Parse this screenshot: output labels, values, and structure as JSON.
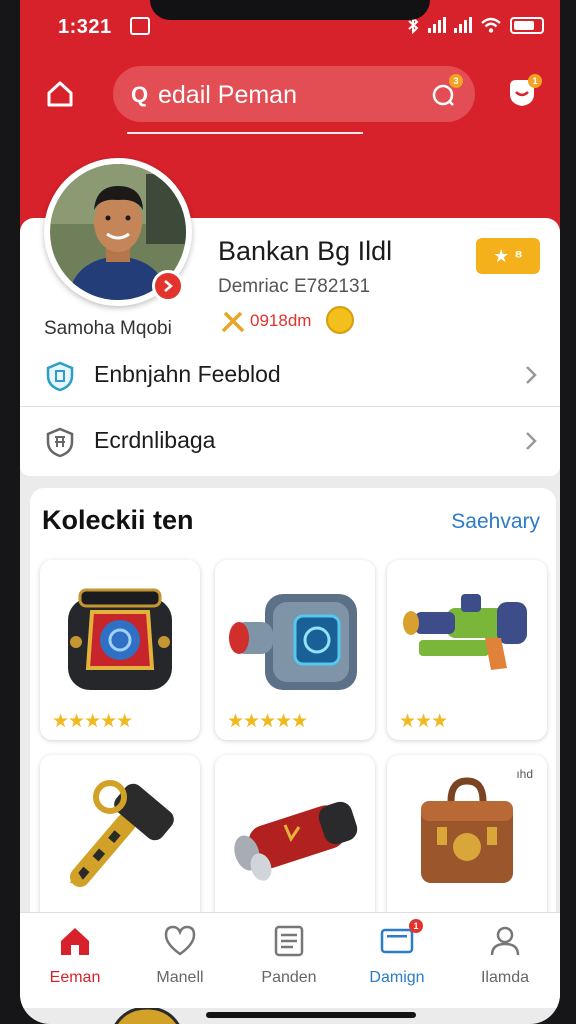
{
  "status_bar": {
    "time": "1:321"
  },
  "header": {
    "search_value": "edail Peman",
    "search_icon_glyph": "Q",
    "notification_badge": "3",
    "chat_badge": "1"
  },
  "profile": {
    "name": "Bankan Bg Ildl",
    "id_line": "Demriac E782131",
    "coins": "0918dm",
    "subname": "Samoha Mqobi",
    "rank_badge": "★ ⁸"
  },
  "menu": [
    {
      "icon": "shield-icon",
      "label": "Enbnjahn Feeblod"
    },
    {
      "icon": "cart-icon",
      "label": "Ecrdnlibaga"
    }
  ],
  "collection": {
    "title": "Koleckii ten",
    "link": "Saehvary",
    "items": [
      {
        "name": "backpack",
        "stars": "★★★★★"
      },
      {
        "name": "canister",
        "stars": "★★★★★"
      },
      {
        "name": "blaster",
        "stars": "★★★"
      },
      {
        "name": "hammer",
        "stars": ""
      },
      {
        "name": "scope",
        "stars": ""
      },
      {
        "name": "chest",
        "stars": "",
        "tag": "ıhd"
      }
    ]
  },
  "nav": [
    {
      "icon": "home-icon",
      "label": "Eeman",
      "active": true,
      "color": "#d8222b"
    },
    {
      "icon": "heart-icon",
      "label": "Manell",
      "active": false
    },
    {
      "icon": "list-icon",
      "label": "Panden",
      "active": false
    },
    {
      "icon": "screen-icon",
      "label": "Damign",
      "active": true,
      "color": "#2c7bc9",
      "badge": "1"
    },
    {
      "icon": "user-icon",
      "label": "Ilamda",
      "active": false
    }
  ],
  "colors": {
    "brand_red": "#d8222b",
    "accent_blue": "#2c7bc9",
    "star_gold": "#f0b91e"
  }
}
